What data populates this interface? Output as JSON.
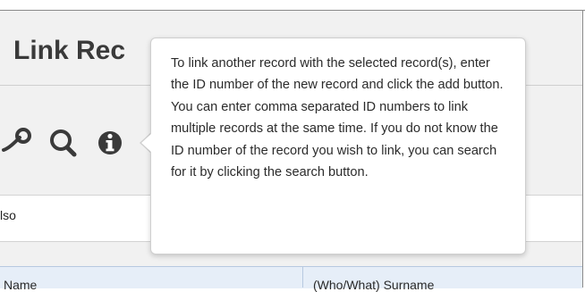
{
  "page": {
    "title": "Link Rec"
  },
  "toolbar": {
    "icons": [
      "link-icon",
      "search-icon",
      "info-icon"
    ]
  },
  "content": {
    "also_label": "lso"
  },
  "table": {
    "columns": [
      "Name",
      "(Who/What) Surname"
    ]
  },
  "tooltip": {
    "text": "To link another record with the selected record(s), enter the ID number of the new record and click the add button. You can enter comma separated ID numbers to link multiple records at the same time. If you do not know the ID number of the record you wish to link, you can search for it by clicking the search button."
  },
  "colors": {
    "header_background": "#f1f1f1",
    "table_header_background": "#e6eef8",
    "icon_color": "#3a3a3a"
  }
}
